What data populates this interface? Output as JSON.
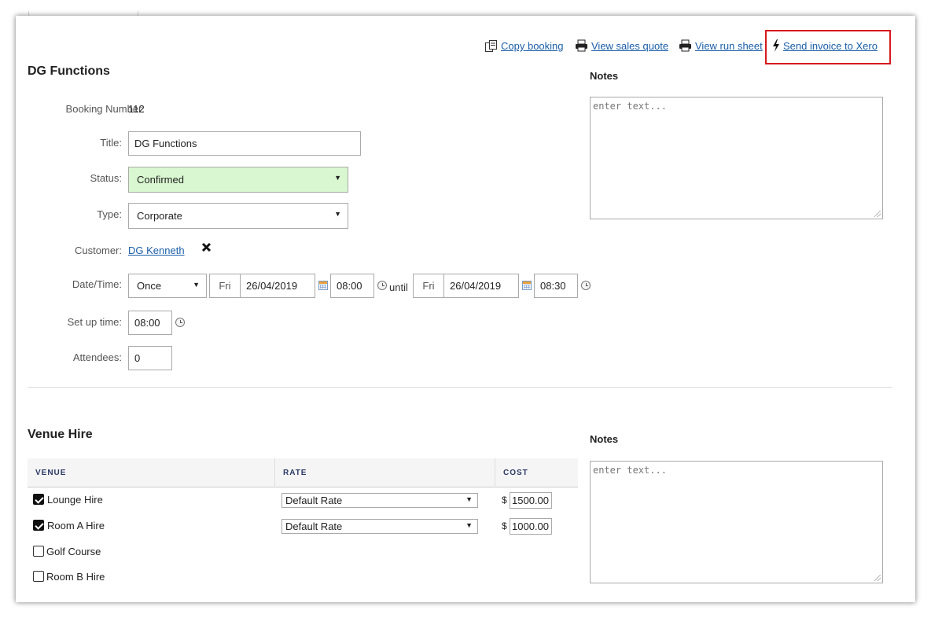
{
  "actions": {
    "copy_booking": "Copy booking",
    "view_sales_quote": "View sales quote",
    "view_run_sheet": "View run sheet",
    "send_invoice": "Send invoice to Xero"
  },
  "highlight_color": "#d7191e",
  "booking": {
    "heading": "DG Functions",
    "booking_number_label": "Booking Number:",
    "booking_number": "112",
    "title_label": "Title:",
    "title_value": "DG Functions",
    "status_label": "Status:",
    "status_value": "Confirmed",
    "status_color": "#d9f7d0",
    "type_label": "Type:",
    "type_value": "Corporate",
    "customer_label": "Customer:",
    "customer_value": "DG Kenneth",
    "datetime_label": "Date/Time:",
    "recurrence": "Once",
    "start_day": "Fri",
    "start_date": "26/04/2019",
    "start_time": "08:00",
    "until_label": "until",
    "end_day": "Fri",
    "end_date": "26/04/2019",
    "end_time": "08:30",
    "setup_label": "Set up time:",
    "setup_time": "08:00",
    "attendees_label": "Attendees:",
    "attendees": "0"
  },
  "notes": {
    "label": "Notes",
    "placeholder": "enter text..."
  },
  "venue_hire": {
    "heading": "Venue Hire",
    "columns": [
      "VENUE",
      "RATE",
      "COST"
    ],
    "currency": "$",
    "rows": [
      {
        "venue": "Lounge Hire",
        "checked": true,
        "rate": "Default Rate",
        "cost": "1500.00"
      },
      {
        "venue": "Room A Hire",
        "checked": true,
        "rate": "Default Rate",
        "cost": "1000.00"
      },
      {
        "venue": "Golf Course",
        "checked": false
      },
      {
        "venue": "Room B Hire",
        "checked": false
      }
    ],
    "notes_label": "Notes",
    "notes_placeholder": "enter text..."
  }
}
